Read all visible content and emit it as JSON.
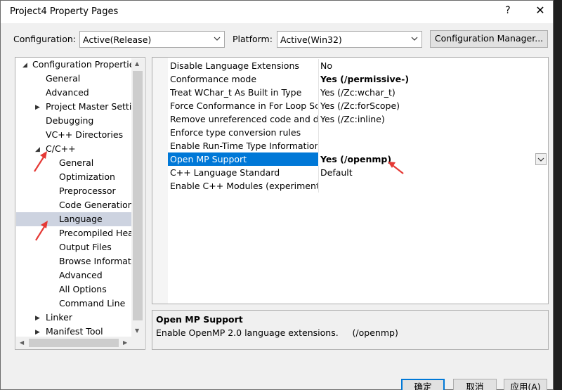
{
  "window": {
    "title": "Project4 Property Pages",
    "help_label": "?",
    "close_label": "✕"
  },
  "config_bar": {
    "configuration_label": "Configuration:",
    "configuration_value": "Active(Release)",
    "platform_label": "Platform:",
    "platform_value": "Active(Win32)",
    "manager_label": "Configuration Manager..."
  },
  "tree": {
    "items": [
      {
        "label": "Configuration Properties",
        "level": 0,
        "expander": "▲"
      },
      {
        "label": "General",
        "level": 1
      },
      {
        "label": "Advanced",
        "level": 1
      },
      {
        "label": "Project Master Settin",
        "level": 1,
        "expander": "▶"
      },
      {
        "label": "Debugging",
        "level": 1
      },
      {
        "label": "VC++ Directories",
        "level": 1
      },
      {
        "label": "C/C++",
        "level": 1,
        "expander": "▲"
      },
      {
        "label": "General",
        "level": 2
      },
      {
        "label": "Optimization",
        "level": 2
      },
      {
        "label": "Preprocessor",
        "level": 2
      },
      {
        "label": "Code Generation",
        "level": 2
      },
      {
        "label": "Language",
        "level": 2,
        "selected": true
      },
      {
        "label": "Precompiled Head",
        "level": 2
      },
      {
        "label": "Output Files",
        "level": 2
      },
      {
        "label": "Browse Informatic",
        "level": 2
      },
      {
        "label": "Advanced",
        "level": 2
      },
      {
        "label": "All Options",
        "level": 2
      },
      {
        "label": "Command Line",
        "level": 2
      },
      {
        "label": "Linker",
        "level": 1,
        "expander": "▶"
      },
      {
        "label": "Manifest Tool",
        "level": 1,
        "expander": "▶"
      }
    ]
  },
  "properties": [
    {
      "name": "Disable Language Extensions",
      "value": "No",
      "bold": false
    },
    {
      "name": "Conformance mode",
      "value": "Yes (/permissive-)",
      "bold": true
    },
    {
      "name": "Treat WChar_t As Built in Type",
      "value": "Yes (/Zc:wchar_t)",
      "bold": false
    },
    {
      "name": "Force Conformance in For Loop Sco",
      "value": "Yes (/Zc:forScope)",
      "bold": false
    },
    {
      "name": "Remove unreferenced code and dat",
      "value": "Yes (/Zc:inline)",
      "bold": false
    },
    {
      "name": "Enforce type conversion rules",
      "value": "",
      "bold": false
    },
    {
      "name": "Enable Run-Time Type Information",
      "value": "",
      "bold": false
    },
    {
      "name": "Open MP Support",
      "value": "Yes (/openmp)",
      "bold": true,
      "selected": true
    },
    {
      "name": "C++ Language Standard",
      "value": "Default",
      "bold": false
    },
    {
      "name": "Enable C++ Modules (experimental)",
      "value": "",
      "bold": false
    }
  ],
  "description": {
    "title": "Open MP Support",
    "text": "Enable OpenMP 2.0 language extensions.     (/openmp)"
  },
  "buttons": {
    "ok": "确定",
    "cancel": "取消",
    "apply": "应用(A)"
  },
  "colors": {
    "selection": "#0078d7",
    "tree_selection": "#cdd3e0",
    "annotation_arrow": "#e53935"
  }
}
